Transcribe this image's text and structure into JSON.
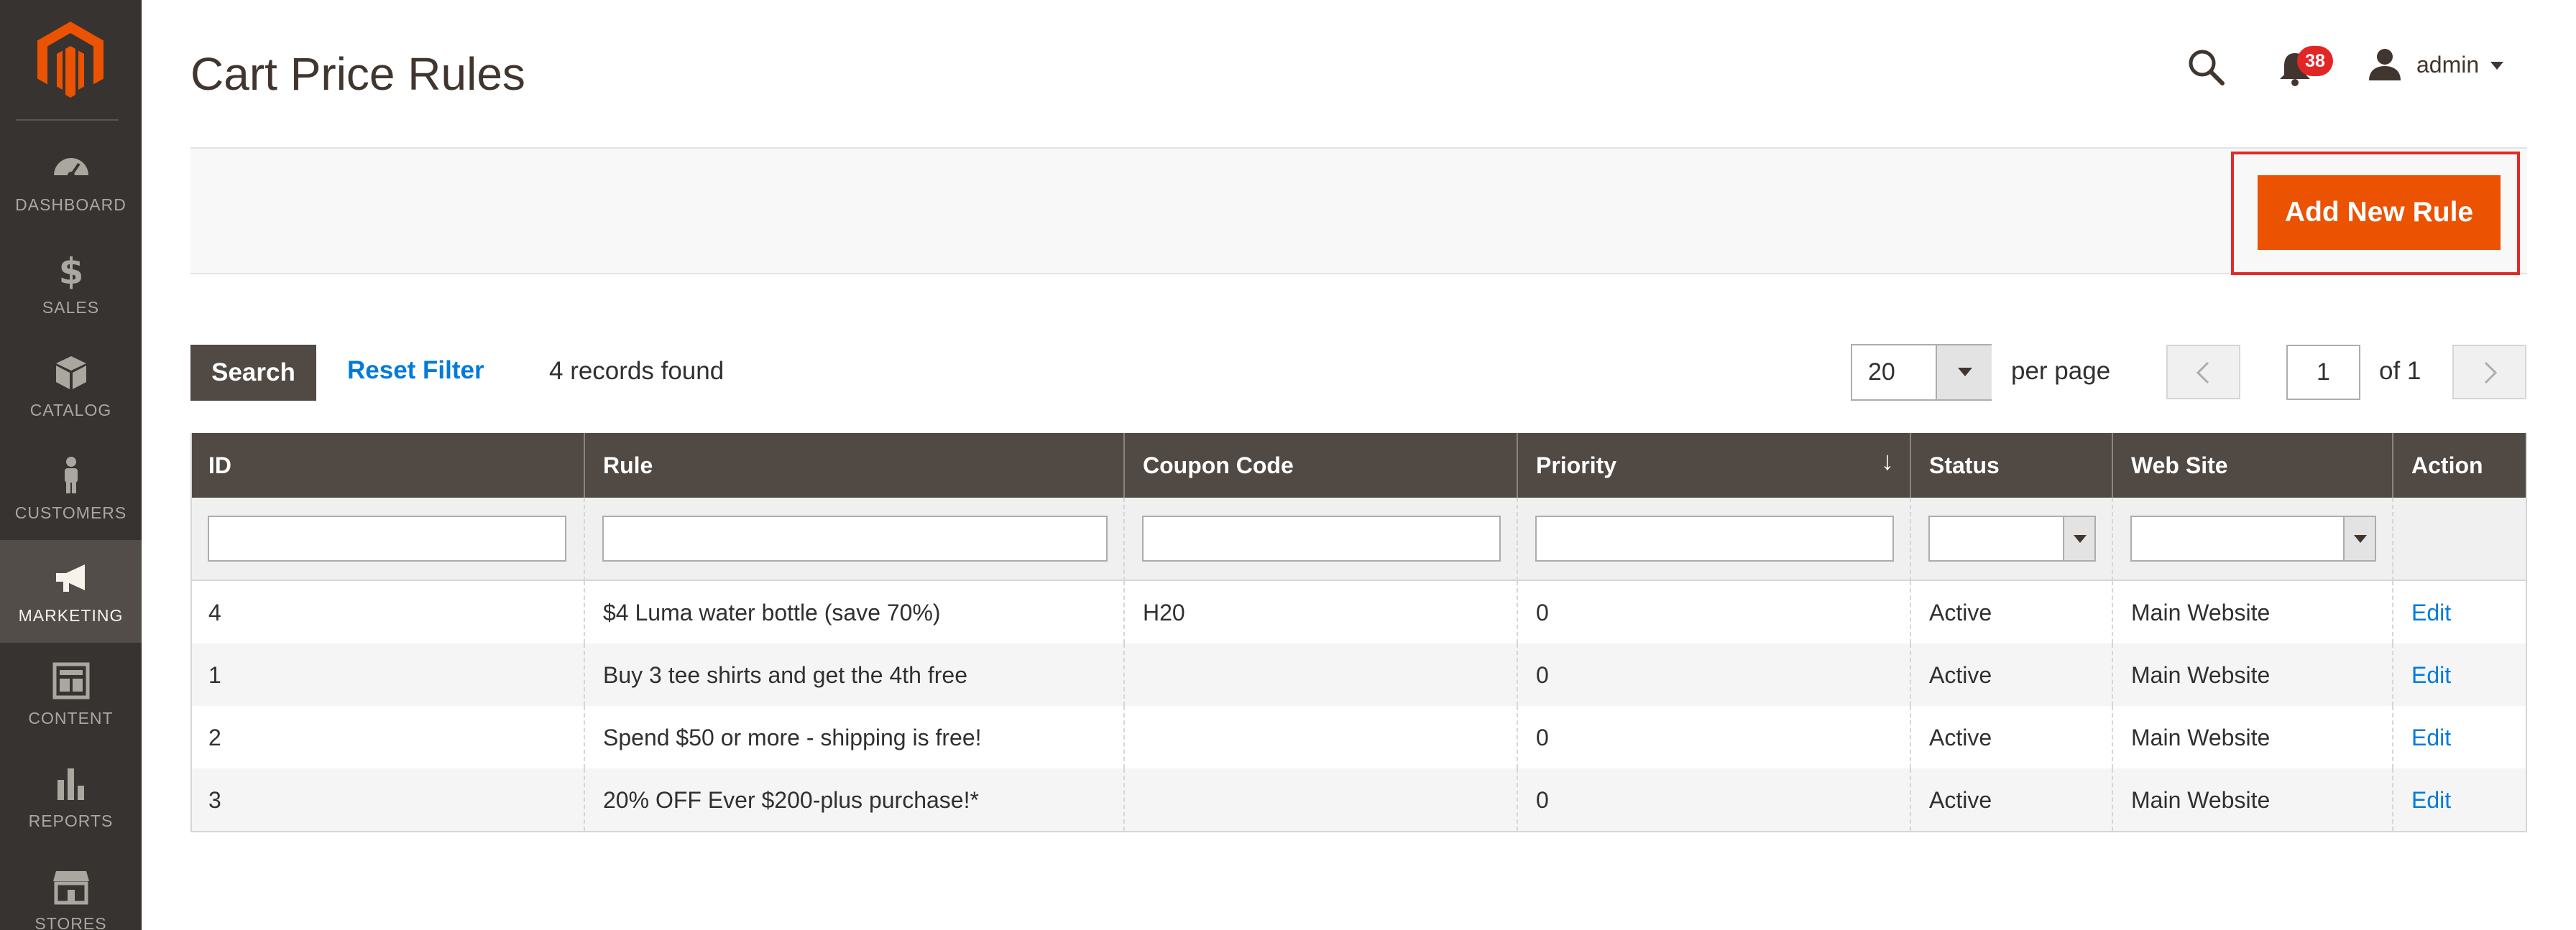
{
  "sidebar": {
    "logo": "magento-logo",
    "items": [
      {
        "label": "DASHBOARD",
        "icon": "dashboard-icon"
      },
      {
        "label": "SALES",
        "icon": "dollar-icon"
      },
      {
        "label": "CATALOG",
        "icon": "cube-icon"
      },
      {
        "label": "CUSTOMERS",
        "icon": "person-icon"
      },
      {
        "label": "MARKETING",
        "icon": "megaphone-icon",
        "active": true
      },
      {
        "label": "CONTENT",
        "icon": "layout-icon"
      },
      {
        "label": "REPORTS",
        "icon": "bar-chart-icon"
      },
      {
        "label": "STORES",
        "icon": "storefront-icon"
      }
    ]
  },
  "header": {
    "title": "Cart Price Rules",
    "notifications_count": "38",
    "username": "admin"
  },
  "actions": {
    "add_new_rule": "Add New Rule"
  },
  "toolbar": {
    "search": "Search",
    "reset_filter": "Reset Filter",
    "records": "4 records found",
    "per_page_value": "20",
    "per_page_label": "per page",
    "current_page": "1",
    "total_pages": "of 1"
  },
  "grid": {
    "columns": [
      "ID",
      "Rule",
      "Coupon Code",
      "Priority",
      "Status",
      "Web Site",
      "Action"
    ],
    "rows": [
      {
        "id": "4",
        "rule": "$4 Luma water bottle (save 70%)",
        "coupon": "H20",
        "priority": "0",
        "status": "Active",
        "website": "Main Website",
        "action": "Edit"
      },
      {
        "id": "1",
        "rule": "Buy 3 tee shirts and get the 4th free",
        "coupon": "",
        "priority": "0",
        "status": "Active",
        "website": "Main Website",
        "action": "Edit"
      },
      {
        "id": "2",
        "rule": "Spend $50 or more - shipping is free!",
        "coupon": "",
        "priority": "0",
        "status": "Active",
        "website": "Main Website",
        "action": "Edit"
      },
      {
        "id": "3",
        "rule": "20% OFF Ever $200-plus purchase!*",
        "coupon": "",
        "priority": "0",
        "status": "Active",
        "website": "Main Website",
        "action": "Edit"
      }
    ]
  },
  "colors": {
    "sidebar_bg": "#373330",
    "accent_orange": "#eb5202",
    "header_dark": "#514943",
    "link_blue": "#007bdb",
    "highlight_red": "#e02b27"
  }
}
